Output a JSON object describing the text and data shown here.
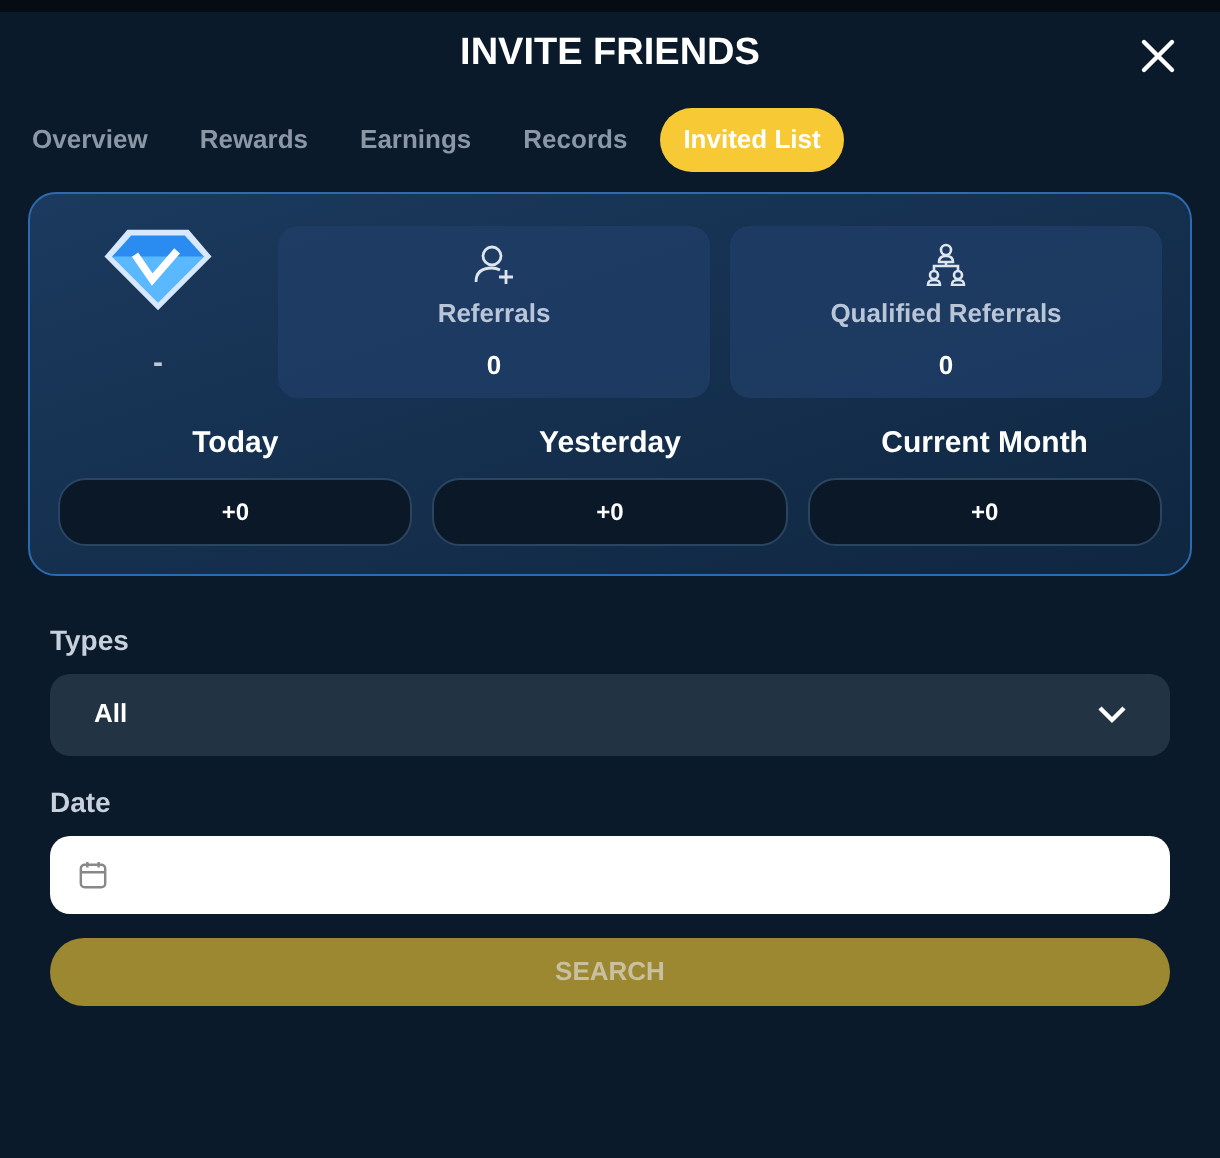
{
  "window": {
    "title": "INVITE FRIENDS"
  },
  "tabs": [
    {
      "label": "Overview",
      "selected": false
    },
    {
      "label": "Rewards",
      "selected": false
    },
    {
      "label": "Earnings",
      "selected": false
    },
    {
      "label": "Records",
      "selected": false
    },
    {
      "label": "Invited List",
      "selected": true
    }
  ],
  "summary": {
    "rank": "-",
    "stats": [
      {
        "kind": "referrals",
        "label": "Referrals",
        "value": "0"
      },
      {
        "kind": "qualified",
        "label": "Qualified Referrals",
        "value": "0"
      }
    ],
    "periods": [
      {
        "label": "Today",
        "value": "+0"
      },
      {
        "label": "Yesterday",
        "value": "+0"
      },
      {
        "label": "Current Month",
        "value": "+0"
      }
    ]
  },
  "filters": {
    "types": {
      "label": "Types",
      "value": "All"
    },
    "date": {
      "label": "Date"
    }
  },
  "search_button": {
    "label": "SEARCH",
    "disabled": true
  }
}
